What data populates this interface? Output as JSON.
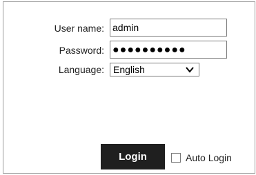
{
  "form": {
    "username_label": "User name:",
    "username_value": "admin",
    "password_label": "Password:",
    "password_mask": "●●●●●●●●●●",
    "language_label": "Language:",
    "language_value": "English",
    "login_label": "Login",
    "auto_login_label": "Auto Login"
  },
  "icons": {
    "language_dropdown": "chevron-down-icon"
  },
  "colors": {
    "button_bg": "#1f1f1f",
    "button_text": "#ffffff",
    "border": "#7a7a7a"
  }
}
